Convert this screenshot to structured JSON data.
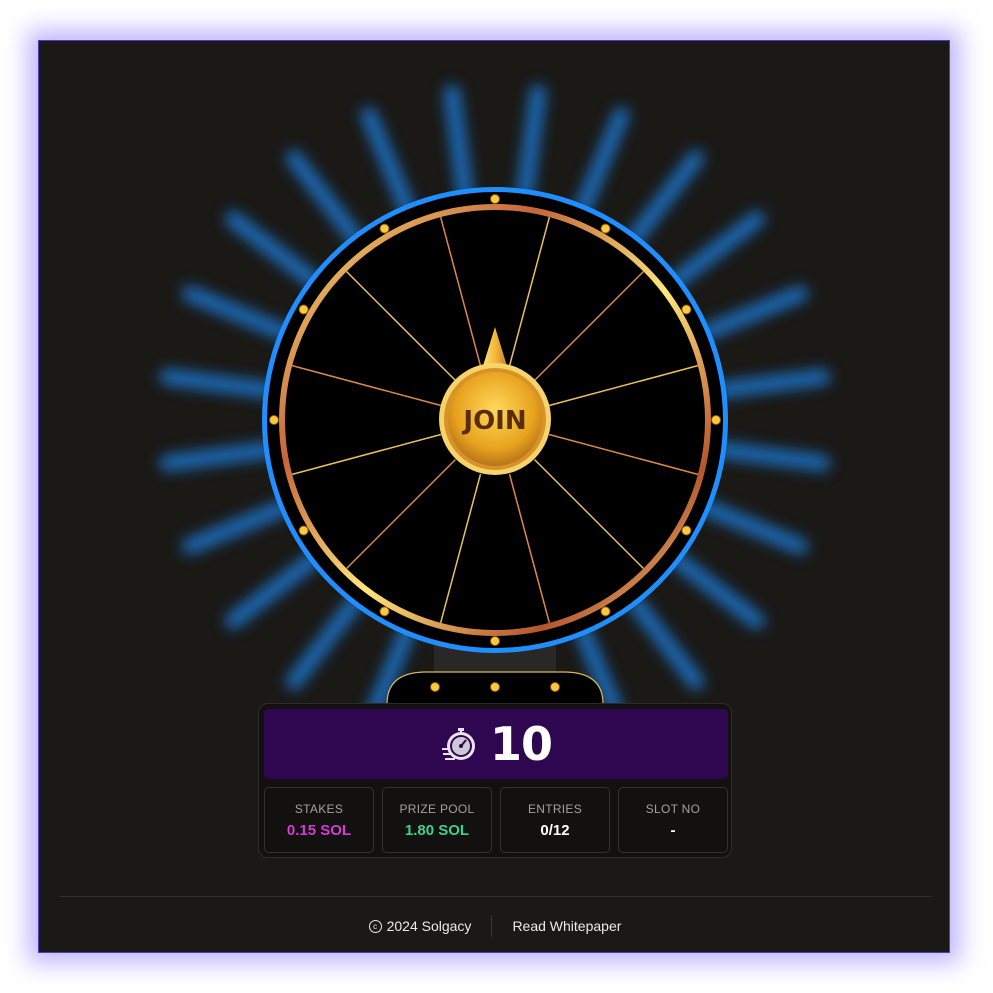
{
  "wheel": {
    "center_label": "JOIN",
    "segments": 12
  },
  "timer": {
    "value": "10",
    "icon": "stopwatch-icon"
  },
  "stats": [
    {
      "label": "STAKES",
      "value": "0.15 SOL",
      "color": "#d63bd8"
    },
    {
      "label": "PRIZE POOL",
      "value": "1.80 SOL",
      "color": "#3fcf8e"
    },
    {
      "label": "ENTRIES",
      "value": "0/12",
      "color": "#ffffff"
    },
    {
      "label": "SLOT NO",
      "value": "-",
      "color": "#ffffff"
    }
  ],
  "footer": {
    "copyright_symbol": "c",
    "copyright": "2024 Solgacy",
    "whitepaper_link": "Read Whitepaper"
  },
  "colors": {
    "background": "#1b1916",
    "glow": "#1f8fff",
    "gold": "#f5c842",
    "copper": "#c4663a",
    "timer_bar": "#2e0750"
  }
}
